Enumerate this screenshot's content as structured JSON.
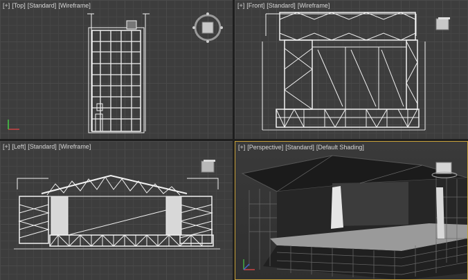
{
  "viewports": {
    "top": {
      "plus": "[+]",
      "view": "[Top]",
      "style": "[Standard]",
      "shading": "[Wireframe]"
    },
    "front": {
      "plus": "[+]",
      "view": "[Front]",
      "style": "[Standard]",
      "shading": "[Wireframe]"
    },
    "left": {
      "plus": "[+]",
      "view": "[Left]",
      "style": "[Standard]",
      "shading": "[Wireframe]"
    },
    "perspective": {
      "plus": "[+]",
      "view": "[Perspective]",
      "style": "[Standard]",
      "shading": "[Default Shading]"
    }
  },
  "colors": {
    "wire": "#f2f2f2",
    "active_border": "#c9a23a",
    "grid": "#4a4a4a"
  },
  "icons": [
    "viewcube-icon",
    "axis-tripod-icon"
  ]
}
